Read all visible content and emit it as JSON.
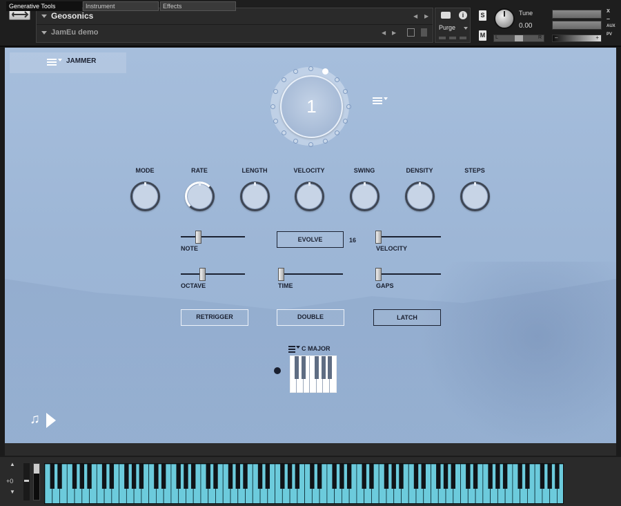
{
  "header": {
    "instrument_name": "Geosonics",
    "multi_name": "JamEu demo",
    "purge_label": "Purge",
    "solo_label": "S",
    "mute_label": "M",
    "tune_label": "Tune",
    "tune_value": "0.00",
    "info_label": "i",
    "close_label": "x",
    "minimize_label": "–",
    "aux_label": "AUX",
    "pv_label": "PV",
    "pan_left": "L",
    "pan_right": "R",
    "vol_minus": "–",
    "vol_plus": "+"
  },
  "main": {
    "menu_label": "JAMMER",
    "dial_value": "1",
    "knobs": [
      {
        "label": "MODE"
      },
      {
        "label": "RATE"
      },
      {
        "label": "LENGTH"
      },
      {
        "label": "VELOCITY"
      },
      {
        "label": "SWING"
      },
      {
        "label": "DENSITY"
      },
      {
        "label": "STEPS"
      }
    ],
    "sliders": {
      "note": "NOTE",
      "velocity": "VELOCITY",
      "octave": "OCTAVE",
      "time": "TIME",
      "gaps": "GAPS"
    },
    "evolve_label": "EVOLVE",
    "evolve_value": "16",
    "buttons": {
      "retrigger": "RETRIGGER",
      "double": "DOUBLE",
      "latch": "LATCH"
    },
    "scale_label": "C MAJOR"
  },
  "tabs": [
    "Generative Tools",
    "Instrument",
    "Effects"
  ],
  "keyboard": {
    "octave_offset": "+0"
  },
  "colors": {
    "panel_bg": "#a0b8d8",
    "keyboard_accent": "#66c6d8",
    "dark_text": "#1a2030"
  }
}
